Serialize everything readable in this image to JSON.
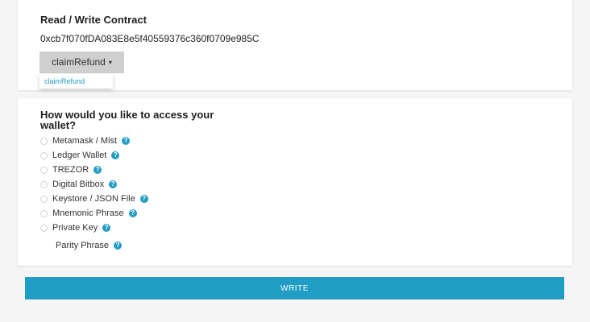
{
  "contract": {
    "title": "Read / Write Contract",
    "address": "0xcb7f070fDA083E8e5f40559376c360f0709e985C",
    "selected_function": "claimRefund",
    "caret": "▾",
    "menu_items": [
      "claimRefund"
    ]
  },
  "access": {
    "title": "How would you like to access your wallet?",
    "options": [
      {
        "label": "Metamask / Mist"
      },
      {
        "label": "Ledger Wallet"
      },
      {
        "label": "TREZOR"
      },
      {
        "label": "Digital Bitbox"
      },
      {
        "label": "Keystore / JSON File"
      },
      {
        "label": "Mnemonic Phrase"
      },
      {
        "label": "Private Key"
      },
      {
        "label": "Parity Phrase"
      }
    ],
    "help_glyph": "?"
  },
  "write_button": {
    "label": "WRITE"
  },
  "colors": {
    "accent": "#1f9dc4",
    "dropdown_bg": "#cfcfcf",
    "page_bg": "#f5f5f5"
  },
  "icons": {
    "help": "question-circle-icon",
    "caret": "caret-down-icon"
  }
}
